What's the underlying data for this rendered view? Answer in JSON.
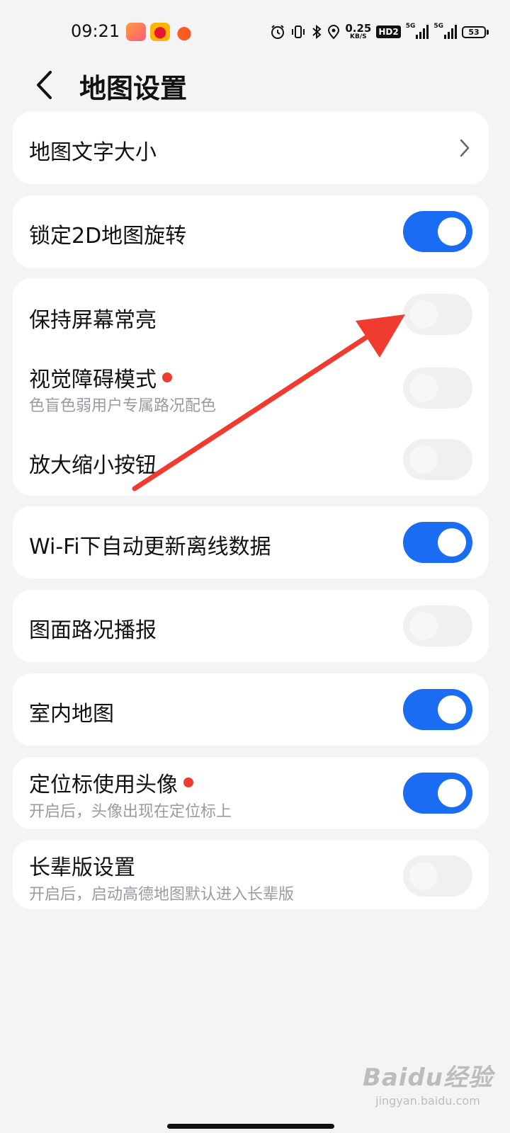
{
  "status_bar": {
    "time": "09:21",
    "net_speed_value": "0.25",
    "net_speed_unit": "KB/S",
    "hd_label": "HD2",
    "sim1_network": "5G",
    "sim2_network": "5G",
    "battery_level": "53",
    "app_icons": [
      "app-notification-icon",
      "weibo-icon",
      "game-app-icon"
    ],
    "system_icons": [
      "alarm-icon",
      "vibrate-icon",
      "bluetooth-icon",
      "location-icon"
    ]
  },
  "header": {
    "back_icon": "chevron-left-icon",
    "title": "地图设置"
  },
  "settings": {
    "map_text_size": {
      "label": "地图文字大小",
      "icon": "chevron-right-icon"
    },
    "lock_2d_rotation": {
      "label": "锁定2D地图旋转",
      "enabled": true
    },
    "keep_screen_on": {
      "label": "保持屏幕常亮",
      "enabled": false
    },
    "visual_impairment_mode": {
      "label": "视觉障碍模式",
      "description": "色盲色弱用户专属路况配色",
      "enabled": false,
      "new_badge": true
    },
    "zoom_buttons": {
      "label": "放大缩小按钮",
      "enabled": false
    },
    "wifi_auto_update": {
      "label": "Wi-Fi下自动更新离线数据",
      "enabled": true
    },
    "traffic_broadcast": {
      "label": "图面路况播报",
      "enabled": false
    },
    "indoor_map": {
      "label": "室内地图",
      "enabled": true
    },
    "avatar_locator": {
      "label": "定位标使用头像",
      "description": "开启后，头像出现在定位标上",
      "enabled": true,
      "new_badge": true
    },
    "elder_mode": {
      "label": "长辈版设置",
      "description": "开启后，启动高德地图默认进入长辈版",
      "enabled": false
    }
  },
  "colors": {
    "switch_on": "#1a6cf2",
    "switch_off": "#f0f0f2",
    "badge_dot": "#f03b30",
    "annotation_arrow": "#f03b30",
    "page_background": "#f4f4f6"
  },
  "watermark": {
    "brand": "Baidu经验",
    "url": "jingyan.baidu.com"
  }
}
